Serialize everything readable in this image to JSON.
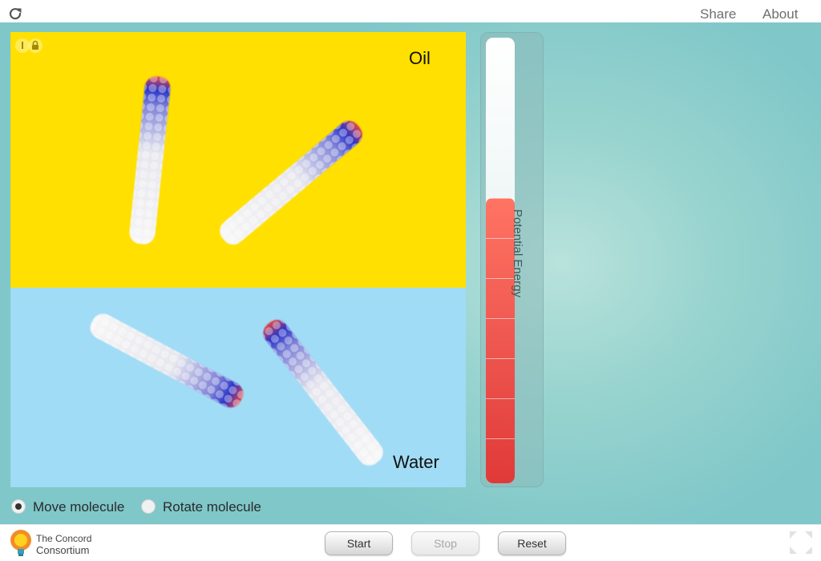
{
  "topbar": {
    "reload_icon": "reload-icon",
    "share_label": "Share",
    "about_label": "About"
  },
  "model": {
    "oil_label": "Oil",
    "water_label": "Water",
    "oil_color": "#ffe000",
    "water_color": "#a0dcf6",
    "badges": [
      "info-icon",
      "lock-icon"
    ]
  },
  "energy_meter": {
    "label": "Potential Energy",
    "level_fraction": 0.64,
    "fill_color": "#e8433f"
  },
  "controls": {
    "mode_options": [
      {
        "label": "Move molecule",
        "selected": true
      },
      {
        "label": "Rotate molecule",
        "selected": false
      }
    ]
  },
  "footer": {
    "logo_line1": "The Concord",
    "logo_line2": "Consortium",
    "start_label": "Start",
    "stop_label": "Stop",
    "reset_label": "Reset",
    "stop_disabled": true,
    "fullscreen_icon": "fullscreen-icon"
  }
}
